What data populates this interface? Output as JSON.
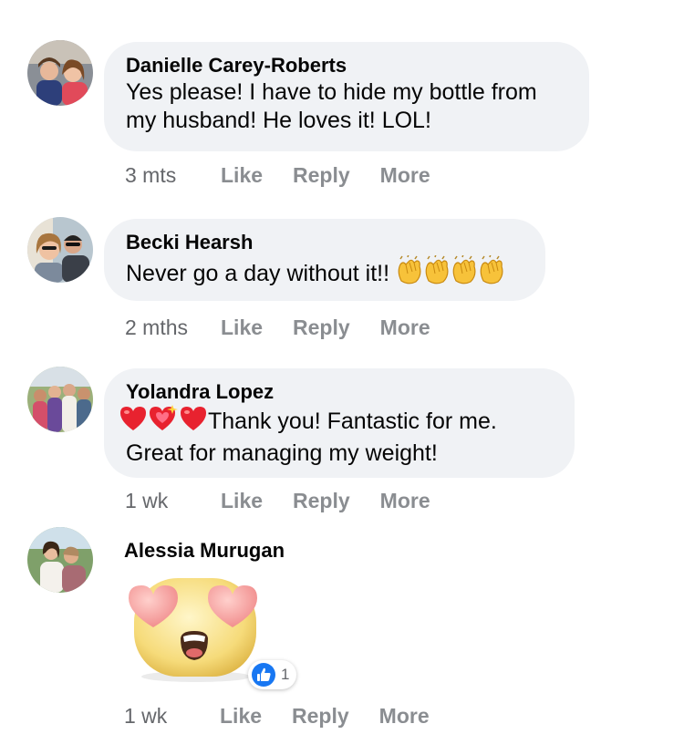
{
  "comments": [
    {
      "author": "Danielle Carey-Roberts",
      "text_line1": "Yes please! I have to hide my bottle from",
      "text_line2": "my husband! He loves it! LOL!",
      "time": "3 mts"
    },
    {
      "author": "Becki Hearsh",
      "text": "Never go a day without it!!",
      "emojis": [
        "clapping-hands",
        "clapping-hands",
        "clapping-hands",
        "clapping-hands"
      ],
      "time": "2 mths"
    },
    {
      "author": "Yolandra Lopez",
      "emojis": [
        "red-heart",
        "sparkling-heart",
        "red-heart"
      ],
      "text_line1": "Thank you! Fantastic for me.",
      "text_line2": "Great for managing my weight!",
      "time": "1 wk"
    },
    {
      "author": "Alessia Murugan",
      "sticker": "heart-eyes-face",
      "reaction_icon": "thumbs-up",
      "reaction_count": "1",
      "time": "1 wk"
    }
  ],
  "actions": {
    "like": "Like",
    "reply": "Reply",
    "more": "More"
  },
  "colors": {
    "bubble": "#f0f2f5",
    "action": "#8a8d91",
    "time": "#65676b",
    "like_blue": "#1877f2"
  }
}
